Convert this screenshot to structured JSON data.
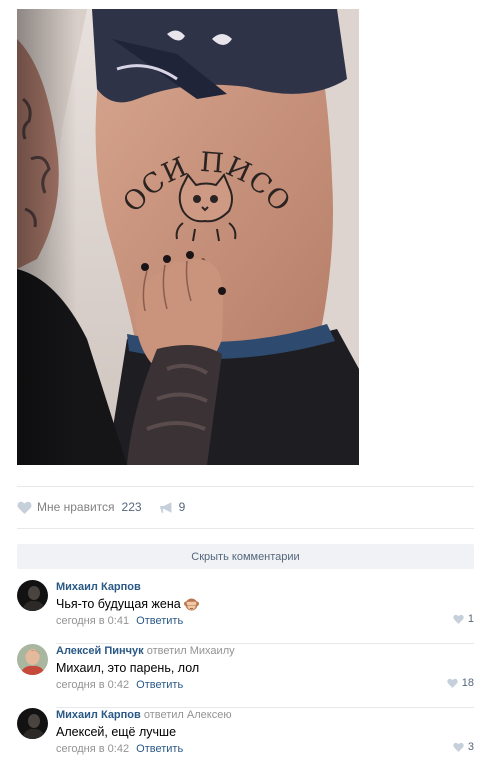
{
  "post": {
    "likes_label": "Мне нравится",
    "likes_count": "223",
    "shares_count": "9",
    "hide_comments_label": "Скрыть комментарии"
  },
  "photo": {
    "tattoo_text": "СОСИ ПИСОС"
  },
  "comments": [
    {
      "author": "Михаил Карпов",
      "reply_to": "",
      "text": "Чья-то будущая жена",
      "time": "сегодня в 0:41",
      "reply_label": "Ответить",
      "likes": "1",
      "emoji": "see-no-evil-monkey"
    },
    {
      "author": "Алексей Пинчук",
      "reply_to": "ответил Михаилу",
      "text": "Михаил, это парень, лол",
      "time": "сегодня в 0:42",
      "reply_label": "Ответить",
      "likes": "18"
    },
    {
      "author": "Михаил Карпов",
      "reply_to": "ответил Алексею",
      "text": "Алексей, ещё лучше",
      "time": "сегодня в 0:42",
      "reply_label": "Ответить",
      "likes": "3"
    }
  ],
  "colors": {
    "link": "#2a5885",
    "muted": "#939393",
    "counter": "#55677d",
    "divider": "#e7e8ec",
    "button_bg": "#f0f2f5"
  }
}
